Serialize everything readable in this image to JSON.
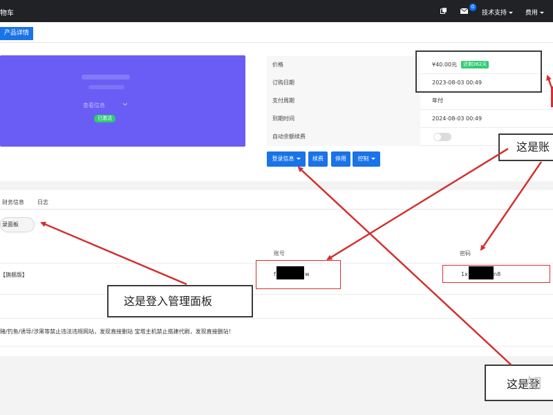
{
  "topbar": {
    "brand": "物车",
    "badge_count": "0",
    "support_label": "技术支持",
    "fee_label": "费用"
  },
  "breadcrumb": {
    "button": "产品详情"
  },
  "product": {
    "sub_label": "查看信息",
    "status": "已激活"
  },
  "info": {
    "rows": [
      {
        "label": "价格",
        "value": "¥40.00元",
        "badge": "还剩362天"
      },
      {
        "label": "订购日期",
        "value": "2023-08-03 00:49"
      },
      {
        "label": "支付周期",
        "value": "年付"
      },
      {
        "label": "到期时间",
        "value": "2024-08-03 00:49"
      },
      {
        "label": "自动余额续费",
        "value": ""
      }
    ],
    "auto_renew_on": false
  },
  "actions": {
    "login_info": "登录信息",
    "renew": "续费",
    "stop": "停用",
    "control": "控制"
  },
  "tabs": {
    "finance": "财务信息",
    "log": "日志",
    "login_panel": "录面板"
  },
  "table": {
    "account_header": "账号",
    "password_header": "密码",
    "product_cell": "【旗舰版】",
    "account_start": "f",
    "account_end": "w",
    "password_start": "1x",
    "password_end": "n8"
  },
  "notice": "赌/钓鱼/诱导/涉黑等禁止违法违规网站，发现直接删站 宝塔主机禁止搭建代刷，发现直接删站！",
  "annotations": {
    "account_note": "这是账",
    "panel_note": "这是登入管理面板",
    "login_note": "这是登"
  },
  "watermark": "知",
  "colors": {
    "topbar": "#202225",
    "accent": "#1a73e8",
    "card": "#6a5df5",
    "success": "#2ecc71",
    "arrow": "#d32f2f"
  }
}
